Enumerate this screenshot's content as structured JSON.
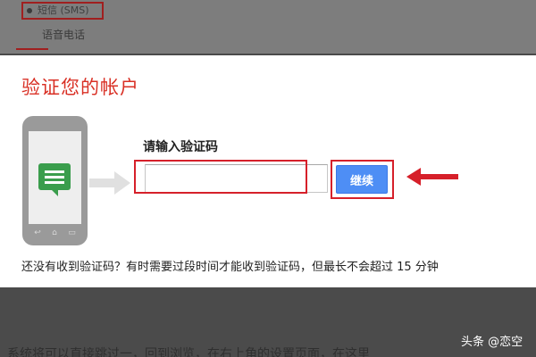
{
  "background": {
    "sms_option": "短信 (SMS)",
    "voice_option": "语音电话",
    "bottom_text": "系统将可以直接跳过一，回到浏览，在右上角的设置页面，在这里"
  },
  "dialog": {
    "title": "验证您的帐户",
    "code_label": "请输入验证码",
    "code_value": "",
    "continue_button": "继续",
    "help_text": "还没有收到验证码？有时需要过段时间才能收到验证码，但最长不会超过 15 分钟"
  },
  "watermark": "头条 @恋空",
  "colors": {
    "title_red": "#d93025",
    "highlight_red": "#d6202a",
    "button_blue": "#4e8ef5",
    "message_green": "#3a9d4c"
  },
  "icons": {
    "phone": "smartphone-icon",
    "message": "message-icon",
    "flow_arrow": "arrow-right-icon",
    "pointer_arrow": "red-arrow-left-icon"
  }
}
